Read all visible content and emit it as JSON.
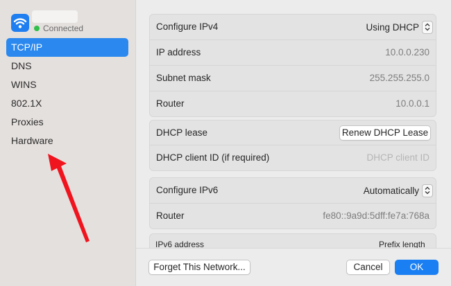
{
  "sidebar": {
    "status_text": "Connected",
    "items": [
      {
        "label": "TCP/IP",
        "active": true
      },
      {
        "label": "DNS"
      },
      {
        "label": "WINS"
      },
      {
        "label": "802.1X"
      },
      {
        "label": "Proxies"
      },
      {
        "label": "Hardware"
      }
    ]
  },
  "ipv4": {
    "configure_label": "Configure IPv4",
    "configure_value": "Using DHCP",
    "ip_label": "IP address",
    "ip_value": "10.0.0.230",
    "subnet_label": "Subnet mask",
    "subnet_value": "255.255.255.0",
    "router_label": "Router",
    "router_value": "10.0.0.1"
  },
  "dhcp": {
    "lease_label": "DHCP lease",
    "renew_button": "Renew DHCP Lease",
    "client_id_label": "DHCP client ID (if required)",
    "client_id_placeholder": "DHCP client ID"
  },
  "ipv6": {
    "configure_label": "Configure IPv6",
    "configure_value": "Automatically",
    "router_label": "Router",
    "router_value": "fe80::9a9d:5dff:fe7a:768a"
  },
  "ipv6_table": {
    "col_address": "IPv6 address",
    "col_prefix": "Prefix length"
  },
  "footer": {
    "forget_button": "Forget This Network...",
    "cancel_button": "Cancel",
    "ok_button": "OK"
  },
  "colors": {
    "accent": "#1a7ff2",
    "status_connected": "#2fbf4a",
    "annotation_arrow": "#f0141e"
  },
  "icons": {
    "wifi": "wifi-icon",
    "stepper": "up-down-chevron-icon",
    "arrow": "red-annotation-arrow"
  }
}
